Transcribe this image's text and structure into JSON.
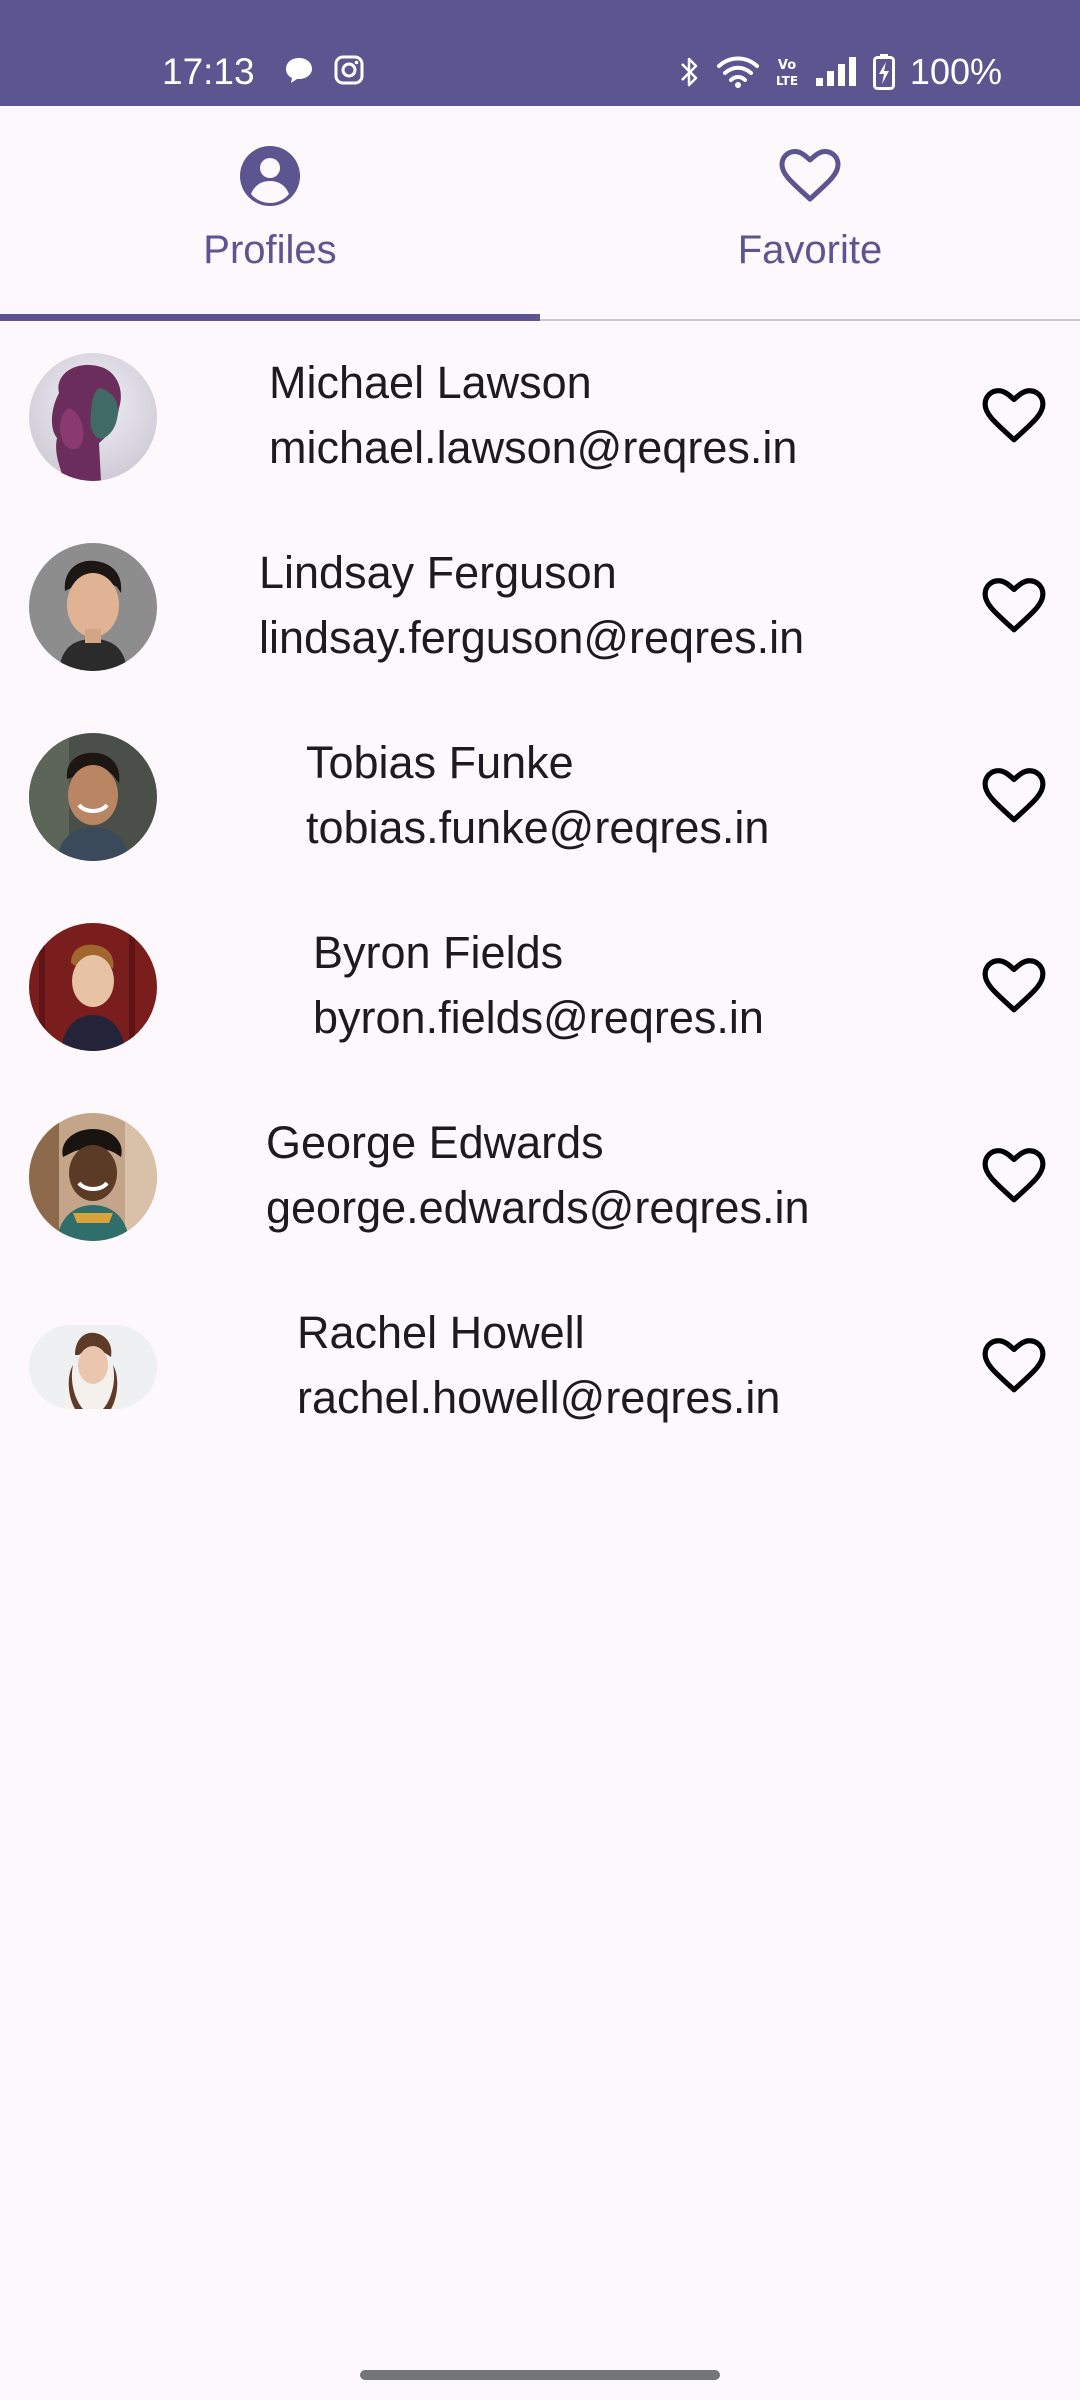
{
  "status_bar": {
    "time": "17:13",
    "battery_text": "100%",
    "left_icons": [
      "chat-bubble-icon",
      "instagram-icon"
    ],
    "right_icons": [
      "bluetooth-icon",
      "wifi-icon",
      "volte-icon",
      "signal-icon",
      "battery-charging-icon"
    ]
  },
  "tabs": [
    {
      "label": "Profiles",
      "icon": "account-circle-icon",
      "selected": true
    },
    {
      "label": "Favorite",
      "icon": "heart-outline-icon",
      "selected": false
    }
  ],
  "profiles": [
    {
      "name": "Michael Lawson",
      "email": "michael.lawson@reqres.in",
      "favorite": false
    },
    {
      "name": "Lindsay Ferguson",
      "email": "lindsay.ferguson@reqres.in",
      "favorite": false
    },
    {
      "name": "Tobias Funke",
      "email": "tobias.funke@reqres.in",
      "favorite": false
    },
    {
      "name": "Byron Fields",
      "email": "byron.fields@reqres.in",
      "favorite": false
    },
    {
      "name": "George Edwards",
      "email": "george.edwards@reqres.in",
      "favorite": false
    },
    {
      "name": "Rachel Howell",
      "email": "rachel.howell@reqres.in",
      "favorite": false
    }
  ],
  "colors": {
    "primary": "#5c558f",
    "background": "#fdf8fc",
    "text": "#1d1b20"
  }
}
